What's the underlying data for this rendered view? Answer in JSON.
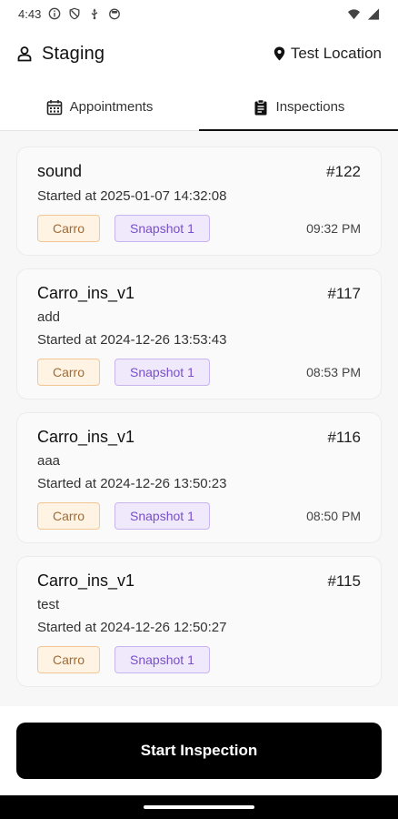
{
  "status_bar": {
    "time": "4:43",
    "left_icons": [
      "info-icon",
      "shield-icon",
      "usb-icon",
      "face-icon"
    ],
    "right_icons": [
      "wifi-icon",
      "signal-icon"
    ]
  },
  "header": {
    "environment": "Staging",
    "location": "Test Location"
  },
  "tabs": [
    {
      "label": "Appointments",
      "icon": "calendar-icon",
      "active": false
    },
    {
      "label": "Inspections",
      "icon": "clipboard-icon",
      "active": true
    }
  ],
  "inspections": [
    {
      "title": "sound",
      "id": "#122",
      "subtitle": "",
      "started": "Started at 2025-01-07 14:32:08",
      "tag1": "Carro",
      "tag2": "Snapshot 1",
      "time": "09:32 PM"
    },
    {
      "title": "Carro_ins_v1",
      "id": "#117",
      "subtitle": "add",
      "started": "Started at 2024-12-26 13:53:43",
      "tag1": "Carro",
      "tag2": "Snapshot 1",
      "time": "08:53 PM"
    },
    {
      "title": "Carro_ins_v1",
      "id": "#116",
      "subtitle": "aaa",
      "started": "Started at 2024-12-26 13:50:23",
      "tag1": "Carro",
      "tag2": "Snapshot 1",
      "time": "08:50 PM"
    },
    {
      "title": "Carro_ins_v1",
      "id": "#115",
      "subtitle": "test",
      "started": "Started at 2024-12-26 12:50:27",
      "tag1": "Carro",
      "tag2": "Snapshot 1",
      "time": ""
    }
  ],
  "actions": {
    "start_label": "Start Inspection"
  },
  "colors": {
    "accent": "#000000",
    "carro_bg": "#fff4e4",
    "carro_text": "#a06a35",
    "snapshot_bg": "#efe9fb",
    "snapshot_text": "#7850c8"
  }
}
